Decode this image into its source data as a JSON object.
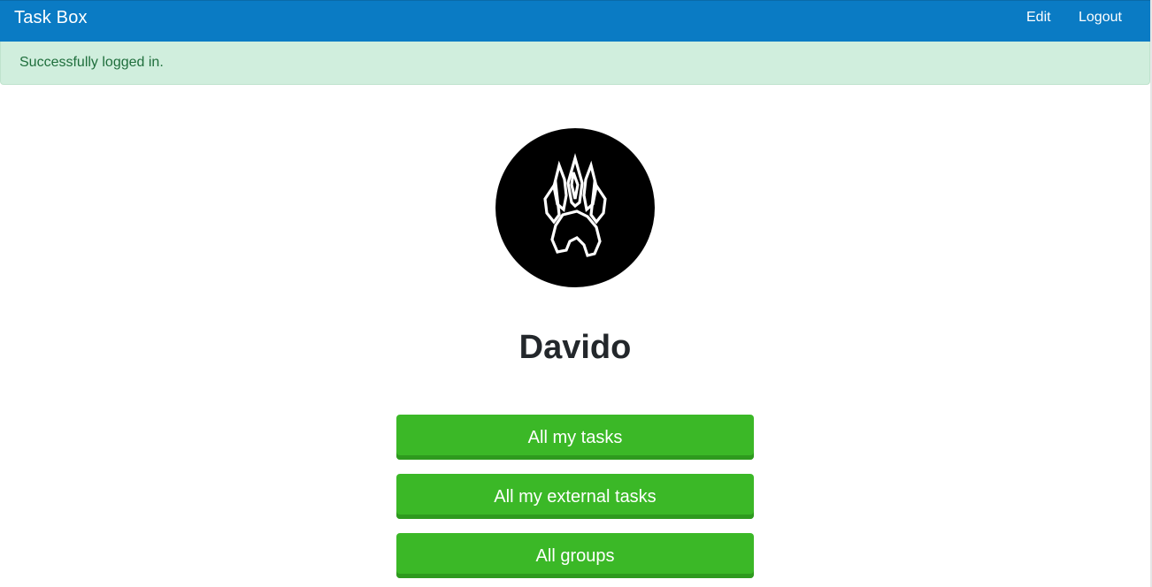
{
  "navbar": {
    "brand": "Task Box",
    "links": [
      {
        "label": "Edit"
      },
      {
        "label": "Logout"
      }
    ],
    "color": "#0a7bc4"
  },
  "alert": {
    "message": "Successfully logged in.",
    "type": "success",
    "background": "#d0eedd"
  },
  "profile": {
    "avatar_icon": "paw-claw-icon",
    "name": "Davido"
  },
  "actions": [
    {
      "label": "All my tasks"
    },
    {
      "label": "All my external tasks"
    },
    {
      "label": "All groups"
    }
  ],
  "button_color": "#3bb827"
}
